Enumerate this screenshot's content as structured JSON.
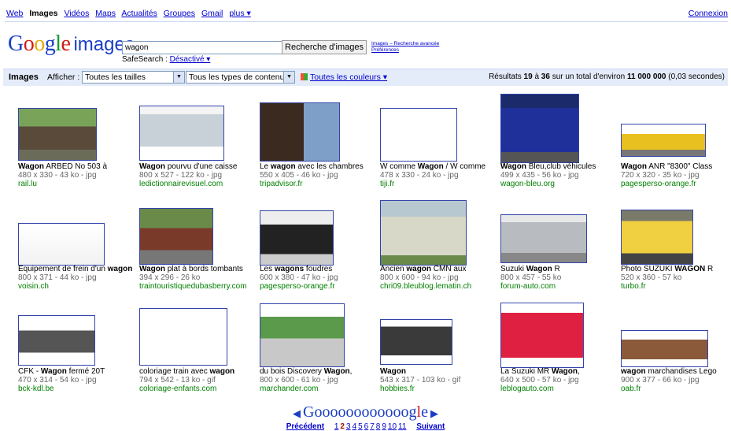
{
  "topnav": {
    "items": [
      "Web",
      "Images",
      "Vidéos",
      "Maps",
      "Actualités",
      "Groupes",
      "Gmail",
      "plus ▾"
    ],
    "signin": "Connexion"
  },
  "logo": {
    "letters": [
      "G",
      "o",
      "o",
      "g",
      "l",
      "e"
    ],
    "sub": "images"
  },
  "search": {
    "query": "wagon",
    "button": "Recherche d'images",
    "adv1": "Images – Recherche avancée",
    "adv2": "Préférences",
    "safesearch_label": "SafeSearch :",
    "safesearch_value": "Désactivé ▾"
  },
  "filters": {
    "title": "Images",
    "show_label": "Afficher :",
    "size": "Toutes les tailles",
    "type": "Tous les types de contenu",
    "colors": "Toutes les couleurs ▾",
    "results_prefix": "Résultats ",
    "results_from": "19",
    "results_mid": " à ",
    "results_to": "36",
    "results_mid2": " sur un total d'environ ",
    "results_total": "11 000 000",
    "results_time": " (0,03 secondes)"
  },
  "results": [
    {
      "pre": "",
      "bold": "Wagon",
      "post": " ARBED No 503 à",
      "meta": "480 x 330 - 43 ko - jpg",
      "url": "rail.lu"
    },
    {
      "pre": "",
      "bold": "Wagon",
      "post": " pourvu d'une caisse",
      "meta": "800 x 527 - 122 ko - jpg",
      "url": "ledictionnairevisuel.com"
    },
    {
      "pre": "Le ",
      "bold": "wagon",
      "post": " avec les chambres",
      "meta": "550 x 405 - 46 ko - jpg",
      "url": "tripadvisor.fr"
    },
    {
      "pre": "W comme ",
      "bold": "Wagon",
      "post": " / W comme",
      "meta": "478 x 330 - 24 ko - jpg",
      "url": "tiji.fr"
    },
    {
      "pre": "",
      "bold": "Wagon",
      "post": " Bleu,club véhicules",
      "meta": "499 x 435 - 56 ko - jpg",
      "url": "wagon-bleu.org"
    },
    {
      "pre": "",
      "bold": "Wagon",
      "post": " ANR \"8300\" Class",
      "meta": "720 x 320 - 35 ko - jpg",
      "url": "pagesperso-orange.fr"
    },
    {
      "pre": "Equipement de frein d'un ",
      "bold": "wagon",
      "post": "",
      "meta": "800 x 371 - 44 ko - jpg",
      "url": "voisin.ch"
    },
    {
      "pre": "",
      "bold": "Wagon",
      "post": " plat à bords tombants",
      "meta": "394 x 296 - 26 ko",
      "url": "traintouristiquedubasberry.com"
    },
    {
      "pre": "Les ",
      "bold": "wagons",
      "post": " foudres",
      "meta": "600 x 380 - 47 ko - jpg",
      "url": "pagesperso-orange.fr"
    },
    {
      "pre": "Ancien ",
      "bold": "wagon",
      "post": " CMN aux",
      "meta": "800 x 600 - 94 ko - jpg",
      "url": "chri09.bleublog.lematin.ch"
    },
    {
      "pre": "Suzuki ",
      "bold": "Wagon",
      "post": " R",
      "meta": "800 x 457 - 55 ko",
      "url": "forum-auto.com"
    },
    {
      "pre": "Photo SUZUKI ",
      "bold": "WAGON",
      "post": " R",
      "meta": "520 x 360 - 57 ko",
      "url": "turbo.fr"
    },
    {
      "pre": "CFK - ",
      "bold": "Wagon",
      "post": " fermé 20T",
      "meta": "470 x 314 - 54 ko - jpg",
      "url": "bck-kdl.be"
    },
    {
      "pre": "coloriage train avec ",
      "bold": "wagon",
      "post": "",
      "meta": "794 x 542 - 13 ko - gif",
      "url": "coloriage-enfants.com"
    },
    {
      "pre": "du bois Discovery ",
      "bold": "Wagon",
      "post": ",",
      "meta": "800 x 600 - 61 ko - jpg",
      "url": "marchander.com"
    },
    {
      "pre": "",
      "bold": "Wagon",
      "post": "",
      "meta": "543 x 317 - 103 ko - gif",
      "url": "hobbies.fr"
    },
    {
      "pre": "La Suzuki MR ",
      "bold": "Wagon",
      "post": ",",
      "meta": "640 x 500 - 57 ko - jpg",
      "url": "leblogauto.com"
    },
    {
      "pre": "",
      "bold": "wagon",
      "post": " marchandises Lego",
      "meta": "900 x 377 - 66 ko - jpg",
      "url": "oab.fr"
    }
  ],
  "pager": {
    "logo": "Goooooooooooogle",
    "prev": "Précédent",
    "next": "Suivant",
    "pages": [
      "1",
      "2",
      "3",
      "4",
      "5",
      "6",
      "7",
      "8",
      "9",
      "10",
      "11"
    ],
    "current": "2"
  }
}
